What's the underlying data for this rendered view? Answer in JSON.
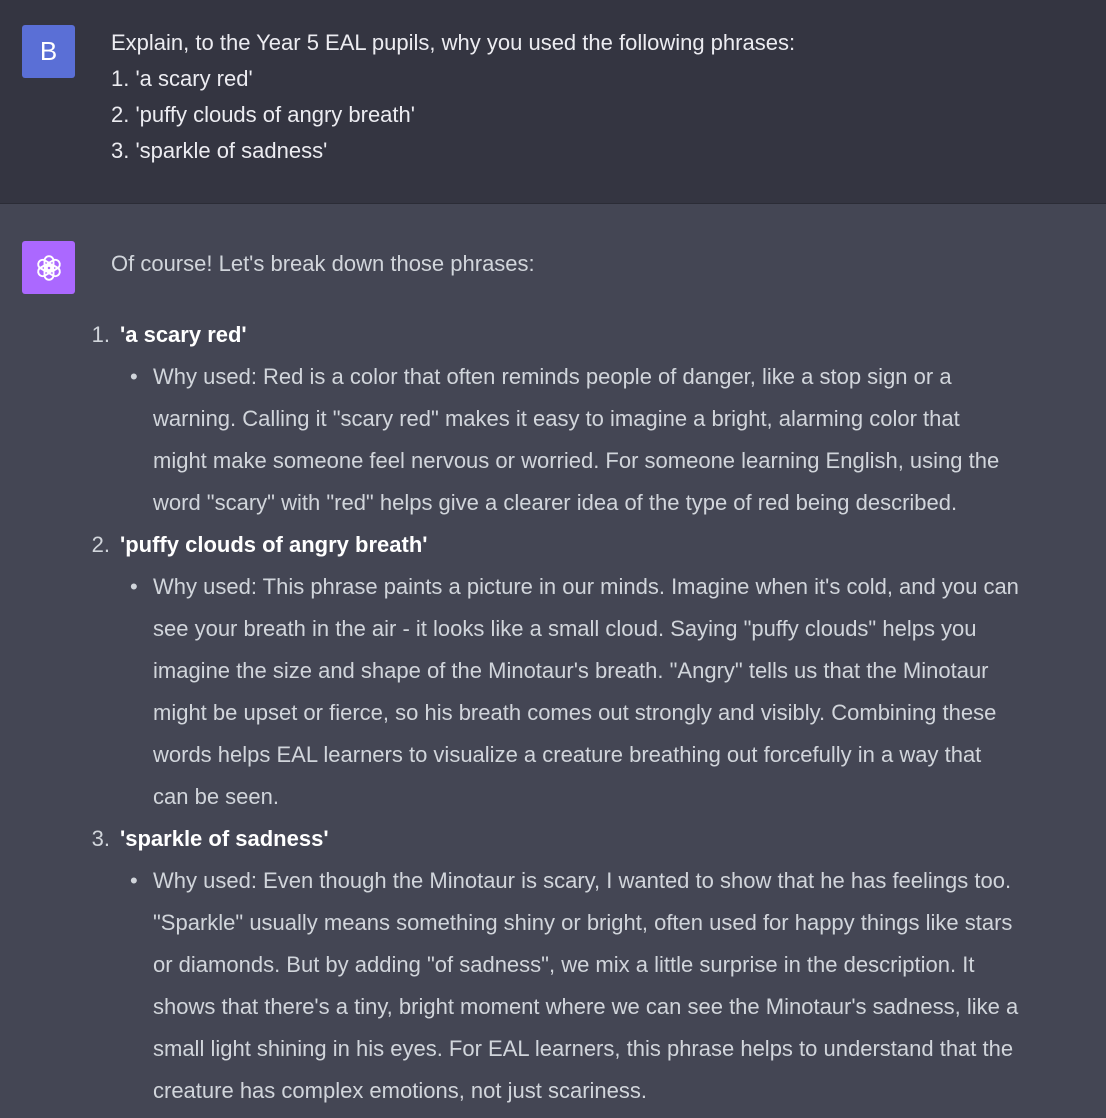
{
  "user": {
    "avatar_letter": "B",
    "lines": [
      "Explain, to the Year 5 EAL pupils, why you used the following phrases:",
      "1. 'a scary red'",
      "2. 'puffy clouds of angry breath'",
      "3. 'sparkle of sadness'"
    ]
  },
  "assistant": {
    "avatar_icon": "openai-logo-icon",
    "avatar_color": "#ab68ff",
    "intro": "Of course! Let's break down those phrases:",
    "items": [
      {
        "number": "1.",
        "title": "'a scary red'",
        "bullet": "•",
        "lines": [
          "Why used: Red is a color that often reminds people of danger, like a stop sign or a",
          "warning. Calling it \"scary red\" makes it easy to imagine a bright, alarming color that",
          "might make someone feel nervous or worried. For someone learning English, using the",
          "word \"scary\" with \"red\" helps give a clearer idea of the type of red being described."
        ]
      },
      {
        "number": "2.",
        "title": "'puffy clouds of angry breath'",
        "bullet": "•",
        "lines": [
          "Why used: This phrase paints a picture in our minds. Imagine when it's cold, and you can",
          "see your breath in the air - it looks like a small cloud. Saying \"puffy clouds\" helps you",
          "imagine the size and shape of the Minotaur's breath. \"Angry\" tells us that the Minotaur",
          "might be upset or fierce, so his breath comes out strongly and visibly. Combining these",
          "words helps EAL learners to visualize a creature breathing out forcefully in a way that",
          "can be seen."
        ]
      },
      {
        "number": "3.",
        "title": "'sparkle of sadness'",
        "bullet": "•",
        "lines": [
          "Why used: Even though the Minotaur is scary, I wanted to show that he has feelings too.",
          "\"Sparkle\" usually means something shiny or bright, often used for happy things like stars",
          "or diamonds. But by adding \"of sadness\", we mix a little surprise in the description. It",
          "shows that there's a tiny, bright moment where we can see the Minotaur's sadness, like a",
          "small light shining in his eyes. For EAL learners, this phrase helps to understand that the",
          "creature has complex emotions, not just scariness."
        ]
      }
    ]
  },
  "colors": {
    "user_bg": "#343541",
    "assistant_bg": "#444654",
    "user_avatar": "#5a6fd6"
  }
}
